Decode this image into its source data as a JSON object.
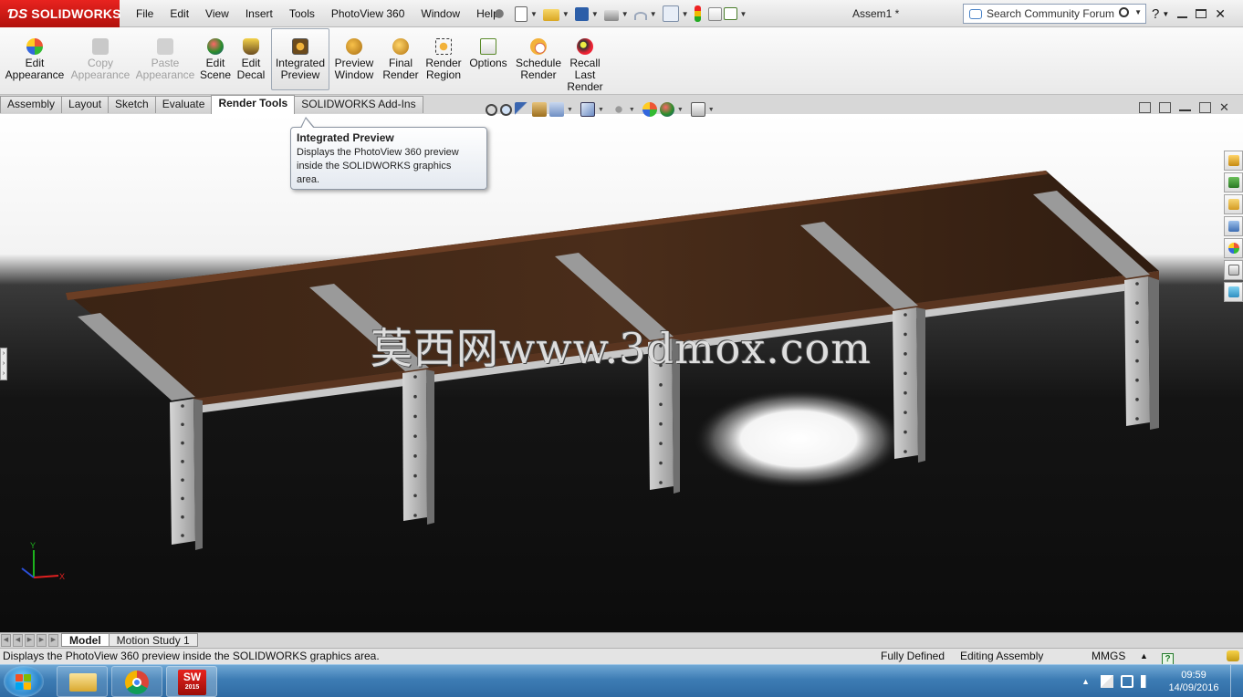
{
  "app": {
    "brand": "SOLIDWORKS",
    "document_title": "Assem1 *",
    "menu": [
      "File",
      "Edit",
      "View",
      "Insert",
      "Tools",
      "PhotoView 360",
      "Window",
      "Help"
    ],
    "search_placeholder": "Search Community Forum"
  },
  "ribbon": {
    "buttons": [
      {
        "id": "edit-appearance",
        "line1": "Edit",
        "line2": "Appearance",
        "line3": "",
        "state": "enabled"
      },
      {
        "id": "copy-appearance",
        "line1": "Copy",
        "line2": "Appearance",
        "line3": "",
        "state": "disabled"
      },
      {
        "id": "paste-appearance",
        "line1": "Paste",
        "line2": "Appearance",
        "line3": "",
        "state": "disabled"
      },
      {
        "id": "edit-scene",
        "line1": "Edit",
        "line2": "Scene",
        "line3": "",
        "state": "enabled"
      },
      {
        "id": "edit-decal",
        "line1": "Edit",
        "line2": "Decal",
        "line3": "",
        "state": "enabled"
      },
      {
        "id": "integrated-preview",
        "line1": "Integrated",
        "line2": "Preview",
        "line3": "",
        "state": "active"
      },
      {
        "id": "preview-window",
        "line1": "Preview",
        "line2": "Window",
        "line3": "",
        "state": "enabled"
      },
      {
        "id": "final-render",
        "line1": "Final",
        "line2": "Render",
        "line3": "",
        "state": "enabled"
      },
      {
        "id": "render-region",
        "line1": "Render",
        "line2": "Region",
        "line3": "",
        "state": "enabled"
      },
      {
        "id": "options",
        "line1": "Options",
        "line2": "",
        "line3": "",
        "state": "enabled"
      },
      {
        "id": "schedule-render",
        "line1": "Schedule",
        "line2": "Render",
        "line3": "",
        "state": "enabled"
      },
      {
        "id": "recall-last-render",
        "line1": "Recall",
        "line2": "Last",
        "line3": "Render",
        "state": "enabled"
      }
    ]
  },
  "command_tabs": [
    "Assembly",
    "Layout",
    "Sketch",
    "Evaluate",
    "Render Tools",
    "SOLIDWORKS Add-Ins"
  ],
  "active_command_tab": "Render Tools",
  "tooltip": {
    "title": "Integrated Preview",
    "line1": "Displays the PhotoView 360 preview",
    "line2": "inside the SOLIDWORKS graphics",
    "line3": "area."
  },
  "watermark": "莫西网www.3dmox.com",
  "model_tabs": [
    "Model",
    "Motion Study 1"
  ],
  "active_model_tab": "Model",
  "status": {
    "message": "Displays the PhotoView 360 preview inside the SOLIDWORKS graphics area.",
    "definition": "Fully Defined",
    "mode": "Editing Assembly",
    "units": "MMGS",
    "units_arrow": "▲",
    "help": "?"
  },
  "triad": {
    "x": "X",
    "y": "Y"
  },
  "taskbar": {
    "clock_time": "09:59",
    "clock_date": "14/09/2016",
    "sw_badge": "2015",
    "sw_text": "SW"
  },
  "colors": {
    "brand_red": "#d51c17",
    "wood": "#3d2416",
    "steel": "#b8b8b8",
    "taskbar_blue": "#3d7cb4"
  }
}
